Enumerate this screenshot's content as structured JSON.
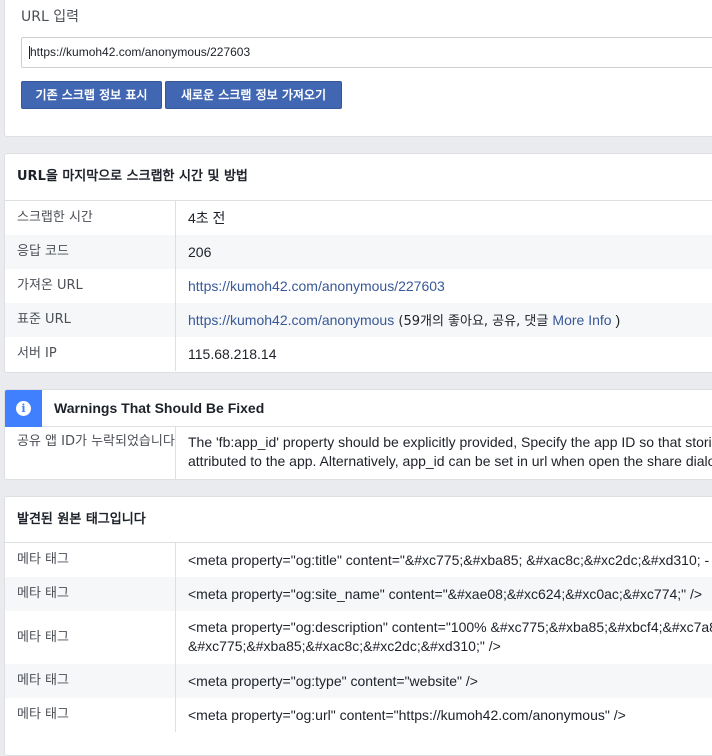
{
  "url_section": {
    "label": "URL 입력",
    "input_value": "https://kumoh42.com/anonymous/227603",
    "buttons": {
      "show_existing": "기존 스크랩 정보 표시",
      "fetch_new": "새로운 스크랩 정보 가져오기"
    }
  },
  "scrape_section": {
    "title": "URL을 마지막으로 스크랩한 시간 및 방법",
    "rows": [
      {
        "label": "스크랩한 시간",
        "value": "4초 전"
      },
      {
        "label": "응답 코드",
        "value": "206"
      },
      {
        "label": "가져온 URL",
        "value": "https://kumoh42.com/anonymous/227603"
      },
      {
        "label": "표준 URL",
        "value": "https://kumoh42.com/anonymous",
        "extra_pre": " (59개의 좋아요, 공유, 댓글 ",
        "extra_link": "More Info",
        "extra_post": " )"
      },
      {
        "label": "서버 IP",
        "value": "115.68.218.14"
      }
    ]
  },
  "warnings_section": {
    "icon": "info-icon",
    "title": "Warnings That Should Be Fixed",
    "rows": [
      {
        "label": "공유 앱 ID가 누락되었습니다",
        "line1": "The 'fb:app_id' property should be explicitly provided, Specify the app ID so that stori",
        "line2": "attributed to the app. Alternatively, app_id can be set in url when open the share dialo"
      }
    ]
  },
  "tags_section": {
    "title": "발견된 원본 태그입니다",
    "rows": [
      {
        "label": "메타 태그",
        "line1": "<meta property=\"og:title\" content=\"&#xc775;&#xba85; &#xac8c;&#xc2dc;&#xd310; -"
      },
      {
        "label": "메타 태그",
        "line1": "<meta property=\"og:site_name\" content=\"&#xae08;&#xc624;&#xc0ac;&#xc774;\" />"
      },
      {
        "label": "메타 태그",
        "line1": "<meta property=\"og:description\" content=\"100% &#xc775;&#xba85;&#xbcf4;&#xc7a8",
        "line2": "&#xc775;&#xba85;&#xac8c;&#xc2dc;&#xd310;\" />"
      },
      {
        "label": "메타 태그",
        "line1": "<meta property=\"og:type\" content=\"website\" />"
      },
      {
        "label": "메타 태그",
        "line1": "<meta property=\"og:url\" content=\"https://kumoh42.com/anonymous\" />"
      }
    ]
  }
}
